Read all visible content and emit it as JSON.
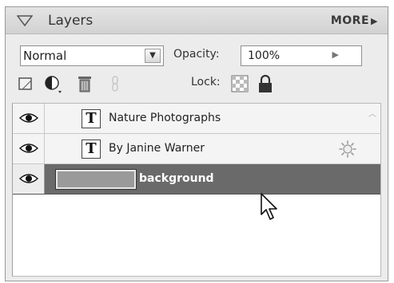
{
  "panel": {
    "title": "Layers",
    "more_label": "MORE",
    "more_icon": "triangle-right-icon"
  },
  "controls": {
    "blend_mode": "Normal",
    "opacity_label": "Opacity:",
    "opacity_value": "100%",
    "lock_label": "Lock:"
  },
  "toolbar": {
    "tools": [
      "new-layer-icon",
      "adjustment-layer-icon",
      "trash-icon",
      "link-icon",
      "lock-transparency-icon",
      "lock-all-icon"
    ]
  },
  "layers": [
    {
      "name": "Nature Photographs",
      "type": "text",
      "visible": true,
      "selected": false
    },
    {
      "name": "By Janine Warner",
      "type": "text",
      "visible": true,
      "selected": false,
      "has_style": true
    },
    {
      "name": "background",
      "type": "image",
      "visible": true,
      "selected": true
    }
  ],
  "colors": {
    "selected_row": "#6a6a6a",
    "panel_bg": "#ececec",
    "list_bg": "#ffffff"
  }
}
